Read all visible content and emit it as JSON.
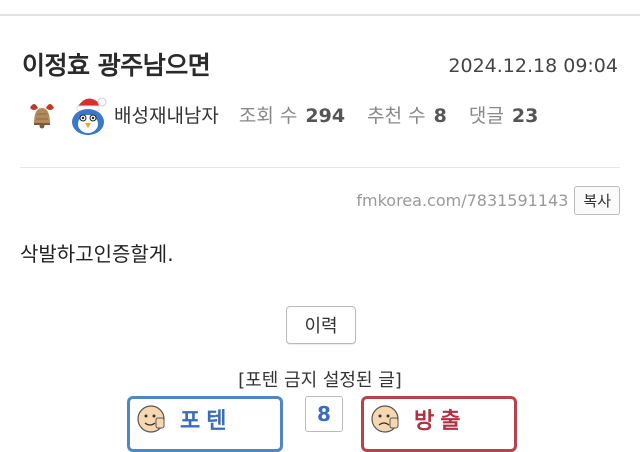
{
  "post": {
    "title": "이정효 광주남으면",
    "date": "2024.12.18 09:04",
    "author": "배성재내남자",
    "views_label": "조회 수",
    "views": "294",
    "recommend_label": "추천 수",
    "recommend": "8",
    "comments_label": "댓글",
    "comments": "23",
    "url": "fmkorea.com/7831591143",
    "copy_label": "복사",
    "content": "삭발하고인증할게.",
    "history_label": "이력",
    "notice": "[포텐 금지 설정된 글]"
  },
  "vote": {
    "up_label": "포텐",
    "count": "8",
    "down_label": "방출"
  },
  "icons": {
    "badge": "bell-wreath-icon",
    "avatar": "santa-bird-avatar-icon",
    "up_face": "thumbs-up-face-icon",
    "down_face": "thumbs-down-face-icon"
  },
  "colors": {
    "up": "#4f86c6",
    "down": "#b8434b"
  }
}
